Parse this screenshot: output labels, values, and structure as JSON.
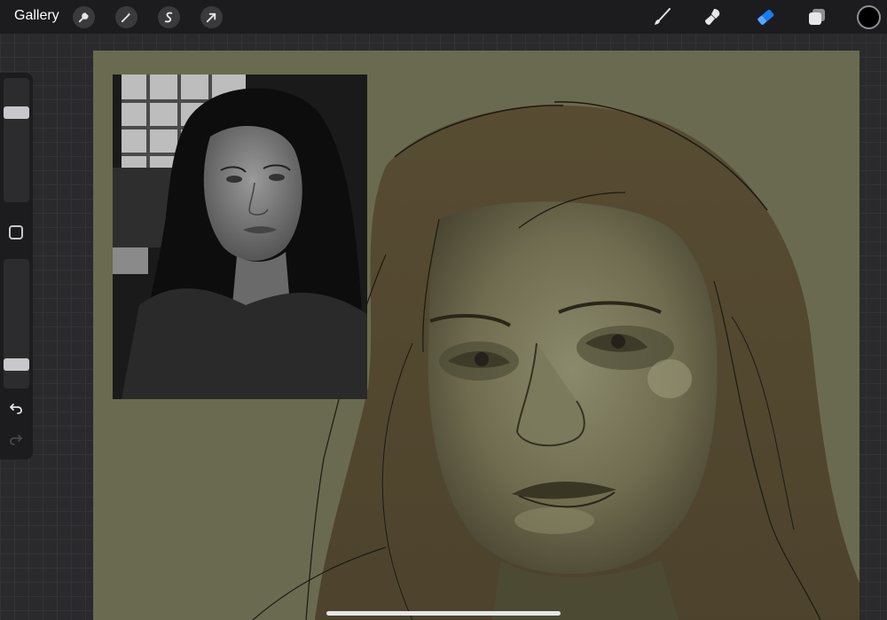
{
  "toolbar": {
    "gallery_label": "Gallery",
    "left_icons": [
      "wrench-icon",
      "magic-wand-icon",
      "selection-icon",
      "transform-arrow-icon"
    ],
    "right_icons": [
      "brush-icon",
      "smudge-icon",
      "eraser-icon",
      "layers-icon"
    ],
    "active_tool": "eraser",
    "active_tool_color": "#1a7cf5",
    "current_color": "#000000"
  },
  "sidebar": {
    "size_slider_level": 0.75,
    "opacity_slider_level": 0.15,
    "icons": [
      "modify-square-icon",
      "undo-icon",
      "redo-icon"
    ]
  },
  "canvas": {
    "background_color": "#6a6a50"
  }
}
